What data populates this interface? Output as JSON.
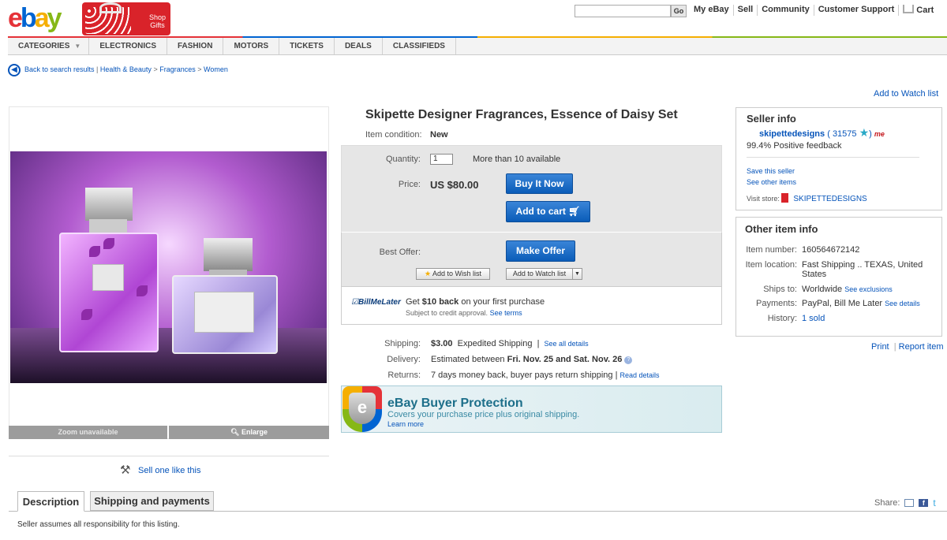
{
  "header": {
    "logo": {
      "e": "e",
      "b": "b",
      "a": "a",
      "y": "y"
    },
    "promo_line1": "Shop",
    "promo_line2": "Gifts",
    "search_placeholder": "",
    "go_label": "Go",
    "links": [
      "My eBay",
      "Sell",
      "Community",
      "Customer Support",
      "Cart"
    ]
  },
  "nav": {
    "tabs": [
      "CATEGORIES",
      "ELECTRONICS",
      "FASHION",
      "MOTORS",
      "TICKETS",
      "DEALS",
      "CLASSIFIEDS"
    ]
  },
  "breadcrumb": {
    "back": "Back to search results",
    "items": [
      "Health & Beauty",
      "Fragrances",
      "Women"
    ]
  },
  "add_watch_top": "Add to Watch list",
  "image": {
    "zoom_label": "Zoom unavailable",
    "enlarge_label": "Enlarge",
    "sell_one": "Sell one like this"
  },
  "item": {
    "title": "Skipette Designer Fragrances, Essence of Daisy Set",
    "condition_label": "Item condition:",
    "condition_value": "New",
    "quantity_label": "Quantity:",
    "quantity_value": "1",
    "available": "More than 10 available",
    "price_label": "Price:",
    "price_value": "US $80.00",
    "buy_now": "Buy It Now",
    "add_to_cart": "Add to cart",
    "best_offer_label": "Best Offer:",
    "make_offer": "Make Offer",
    "add_wish": "Add to Wish list",
    "add_watch": "Add to Watch list",
    "bml_logo": "BillMeLater",
    "bml_pre": "Get",
    "bml_amount": "$10 back",
    "bml_post": "on your first purchase",
    "bml_sub": "Subject to credit approval.",
    "bml_terms": "See terms"
  },
  "shipping": {
    "ship_label": "Shipping:",
    "ship_cost": "$3.00",
    "ship_method": "Expedited Shipping",
    "ship_link": "See all details",
    "delivery_label": "Delivery:",
    "delivery_pre": "Estimated between",
    "delivery_from": "Fri. Nov. 25",
    "delivery_and": "and",
    "delivery_to": "Sat. Nov. 26",
    "returns_label": "Returns:",
    "returns_value": "7 days money back, buyer pays return shipping",
    "returns_link": "Read details"
  },
  "protection": {
    "title": "eBay Buyer Protection",
    "sub": "Covers your purchase price plus original shipping.",
    "learn": "Learn more",
    "shield_letter": "e"
  },
  "seller": {
    "title": "Seller info",
    "name": "skipettedesigns",
    "score": "31575",
    "me_badge": "me",
    "feedback": "99.4% Positive feedback",
    "save": "Save this seller",
    "other": "See other items",
    "visit_label": "Visit store:",
    "store": "SKIPETTEDESIGNS"
  },
  "other_info": {
    "title": "Other item info",
    "item_number_label": "Item number:",
    "item_number": "160564672142",
    "location_label": "Item location:",
    "location": "Fast Shipping .. TEXAS, United States",
    "ships_label": "Ships to:",
    "ships": "Worldwide",
    "ships_link": "See exclusions",
    "payments_label": "Payments:",
    "payments": "PayPal, Bill Me Later",
    "payments_link": "See details",
    "history_label": "History:",
    "history": "1 sold"
  },
  "print_label": "Print",
  "report_label": "Report item",
  "tabs": {
    "description": "Description",
    "shipping": "Shipping and payments"
  },
  "share_label": "Share:",
  "disclaimer": "Seller assumes all responsibility for this listing."
}
